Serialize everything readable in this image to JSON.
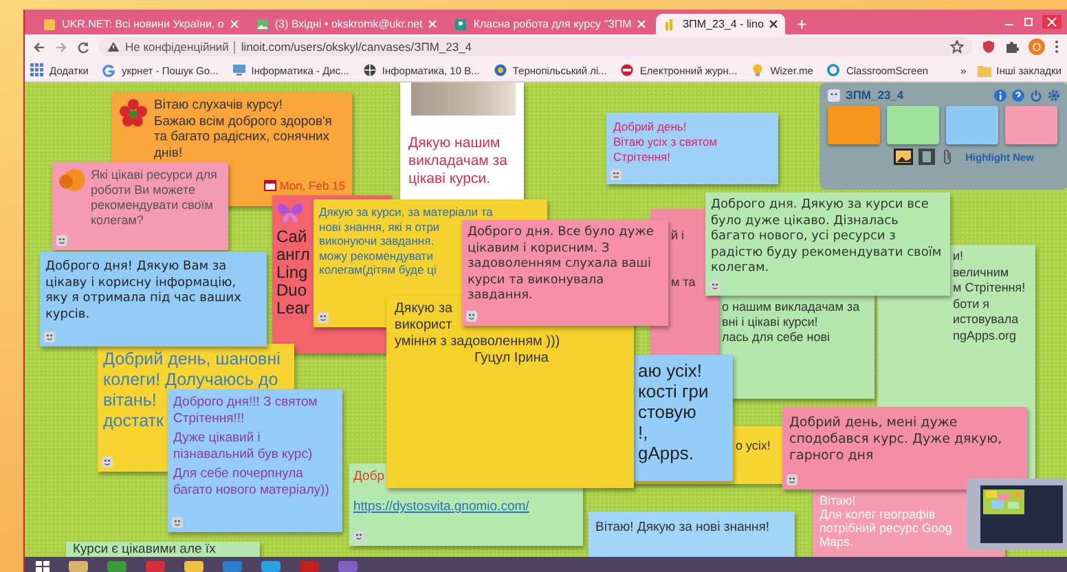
{
  "browser": {
    "tabs": [
      {
        "title": "UKR.NET: Всі новини України, о",
        "selected": false
      },
      {
        "title": "(3) Вхідні • okskromk@ukr.net",
        "selected": false
      },
      {
        "title": "Класна робота для курсу \"ЗПМ",
        "selected": false
      },
      {
        "title": "ЗПМ_23_4 - lino",
        "selected": true
      }
    ],
    "new_tab": "+",
    "security_label": "Не конфіденційний",
    "url": "linoit.com/users/okskyl/canvases/ЗПМ_23_4",
    "profile_initial": "O",
    "bookmarks": [
      {
        "label": "Додатки"
      },
      {
        "label": "укрнет - Пошук Go..."
      },
      {
        "label": "Інформатика - Дис..."
      },
      {
        "label": "Інформатика, 10 В..."
      },
      {
        "label": "Тернопільський лі..."
      },
      {
        "label": "Електронний журн..."
      },
      {
        "label": "Wizer.me"
      },
      {
        "label": "ClassroomScreen"
      }
    ],
    "more_bookmarks": "»",
    "other_bookmarks": "Інші закладки"
  },
  "panel": {
    "title": "ЗПМ_23_4",
    "stickers": [
      {
        "color": "#f7941d"
      },
      {
        "color": "#9ee39a"
      },
      {
        "color": "#8ec8f5"
      },
      {
        "color": "#f59ab0"
      }
    ],
    "highlight_link": "Highlight New"
  },
  "notes": [
    {
      "kind": "text",
      "color": "#f9a53a",
      "texts": [
        "Вітаю слухачів курсу!",
        "Бажаю всім доброго здоров'я та багато радісних, сонячних днів!"
      ],
      "date": "Mon, Feb 15"
    },
    {
      "kind": "photo",
      "color": "#ffffff",
      "texts": [
        "Дякую нашим викладачам за цікаві курси."
      ]
    },
    {
      "kind": "text",
      "color": "#9fd0f7",
      "texts": [
        "Добрий день!",
        "Вітаю усіх з святом Стрітення!"
      ]
    },
    {
      "kind": "text",
      "color": "#f49ab4",
      "texts": [
        "Які цікаві ресурси для роботи Ви можете рекомендувати своїм колегам?"
      ]
    },
    {
      "kind": "text",
      "color": "#f2636b",
      "texts": [
        "Сай",
        "англ",
        "Ling",
        "Duo",
        "Lear"
      ]
    },
    {
      "kind": "text",
      "color": "#f6d22e",
      "texts": [
        "Дякую за курси, за матеріали та",
        "нові знання, які я отри",
        "виконуючи завдання.",
        "можу рекомендувати",
        "колегам(дітям буде ці"
      ]
    },
    {
      "kind": "text",
      "color": "#f590a8",
      "texts": [
        "Доброго дня. Все було дуже цікавим і корисним. З задоволенням слухала ваші курси та виконувала завдання."
      ]
    },
    {
      "kind": "text",
      "color": "#f28aa2",
      "texts": [
        "й і",
        "м та"
      ]
    },
    {
      "kind": "text",
      "color": "#b5e8ae",
      "texts": [
        "Доброго дня. Дякую за курси все було дуже цікаво. Дізналась багато нового, усі ресурси з радістю буду рекомендувати своїм колегам."
      ]
    },
    {
      "kind": "text",
      "color": "#92cbf6",
      "texts": [
        "Доброго дня! Дякую Вам за цікаву і корисну інформацію, яку я отримала під час ваших курсів."
      ]
    },
    {
      "kind": "text",
      "color": "#f5d12c",
      "texts": [
        "Дякую за",
        "використ",
        "уміння з задоволенням )))",
        "Гуцул Ірина"
      ]
    },
    {
      "kind": "text",
      "color": "#b3e6ac",
      "texts": [
        "о нашим викладачам за",
        "вні і цікаві курси!",
        "лась для себе нові"
      ]
    },
    {
      "kind": "text",
      "color": "#b8e8b0",
      "texts": [
        "и!",
        "величним",
        "м Стрітення!",
        "боти я",
        "истовувала",
        "ngApps.org"
      ]
    },
    {
      "kind": "text",
      "color": "#f7d430",
      "texts": [
        "Добрий день, шановні",
        "колеги! Долучаюсь до",
        "вітань!",
        "достатк"
      ]
    },
    {
      "kind": "text",
      "color": "#94ccf7",
      "texts": [
        "Доброго дня!!! З святом Стрітення!!!",
        "Дуже цікавий і пізнавальний був курс)",
        "Для себе почерпнула багато нового матеріалу))"
      ]
    },
    {
      "kind": "text",
      "color": "#96cdf8",
      "texts": [
        "аю усіх!",
        "кості гри",
        "стовую",
        "!,",
        "gApps."
      ]
    },
    {
      "kind": "text",
      "color": "#f8d632",
      "texts": [
        "о усіх!"
      ]
    },
    {
      "kind": "text",
      "color": "#f48ea6",
      "texts": [
        "Добрий день, мені дуже сподобався курс. Дуже дякую, гарного дня"
      ]
    },
    {
      "kind": "text",
      "color": "#b6e9af",
      "texts": [
        "Добр"
      ],
      "link": "https://dystosvita.gnomio.com/"
    },
    {
      "kind": "text",
      "color": "#a2d3f8",
      "texts": [
        "Вітаю! Дякую за нові знання!"
      ]
    },
    {
      "kind": "text",
      "color": "#f59ab0",
      "texts": [
        "Вітаю!",
        "Для колег географів",
        "потрібний ресурс Goog",
        "Maps."
      ]
    },
    {
      "kind": "text",
      "color": "#b4e7ad",
      "texts": [
        "Курси є цікавими але їх"
      ]
    }
  ]
}
